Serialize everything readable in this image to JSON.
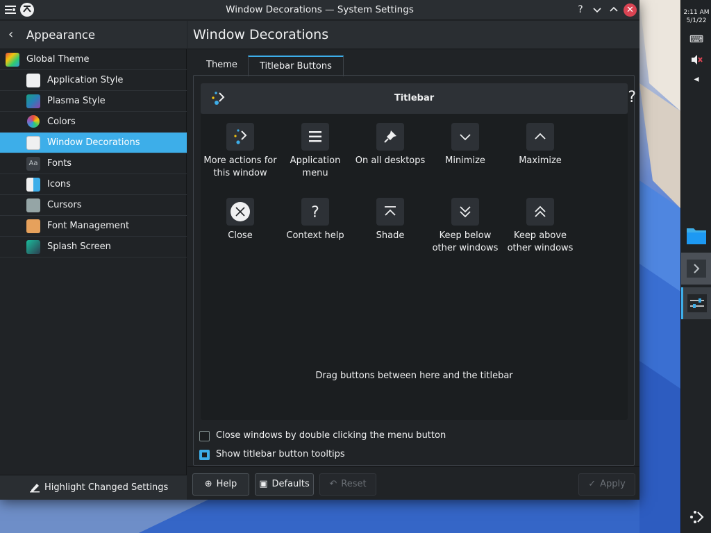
{
  "window": {
    "title": "Window Decorations — System Settings"
  },
  "sidebar": {
    "header": "Appearance",
    "items": [
      {
        "label": "Global Theme",
        "icon": "global-theme-icon",
        "selected": false
      },
      {
        "label": "Application Style",
        "icon": "application-style-icon",
        "selected": false
      },
      {
        "label": "Plasma Style",
        "icon": "plasma-style-icon",
        "selected": false
      },
      {
        "label": "Colors",
        "icon": "colors-icon",
        "selected": false
      },
      {
        "label": "Window Decorations",
        "icon": "window-decorations-icon",
        "selected": true
      },
      {
        "label": "Fonts",
        "icon": "fonts-icon",
        "selected": false
      },
      {
        "label": "Icons",
        "icon": "icons-icon",
        "selected": false
      },
      {
        "label": "Cursors",
        "icon": "cursors-icon",
        "selected": false
      },
      {
        "label": "Font Management",
        "icon": "font-management-icon",
        "selected": false
      },
      {
        "label": "Splash Screen",
        "icon": "splash-screen-icon",
        "selected": false
      }
    ],
    "footer": "Highlight Changed Settings"
  },
  "main": {
    "title": "Window Decorations",
    "tabs": [
      {
        "label": "Theme",
        "active": false
      },
      {
        "label": "Titlebar Buttons",
        "active": true
      }
    ],
    "titlebar_preview": {
      "title": "Titlebar",
      "help": "?"
    },
    "buttons": [
      {
        "label": "More actions for this window",
        "icon": "more-actions-icon"
      },
      {
        "label": "Application menu",
        "icon": "application-menu-icon"
      },
      {
        "label": "On all desktops",
        "icon": "pin-icon"
      },
      {
        "label": "Minimize",
        "icon": "chevron-down-icon"
      },
      {
        "label": "Maximize",
        "icon": "chevron-up-icon"
      },
      {
        "label": "Close",
        "icon": "close-icon"
      },
      {
        "label": "Context help",
        "icon": "help-icon"
      },
      {
        "label": "Shade",
        "icon": "shade-icon"
      },
      {
        "label": "Keep below other windows",
        "icon": "keep-below-icon"
      },
      {
        "label": "Keep above other windows",
        "icon": "keep-above-icon"
      }
    ],
    "drag_hint": "Drag buttons between here and the titlebar",
    "checkboxes": [
      {
        "label": "Close windows by double clicking the menu button",
        "checked": false
      },
      {
        "label": "Show titlebar button tooltips",
        "checked": true
      }
    ],
    "footer": {
      "help": "Help",
      "defaults": "Defaults",
      "reset": "Reset",
      "apply": "Apply"
    }
  },
  "panel": {
    "time": "2:11 AM",
    "date": "5/1/22"
  },
  "colors": {
    "accent": "#3daee9",
    "close": "#da4453",
    "background": "#202326"
  }
}
